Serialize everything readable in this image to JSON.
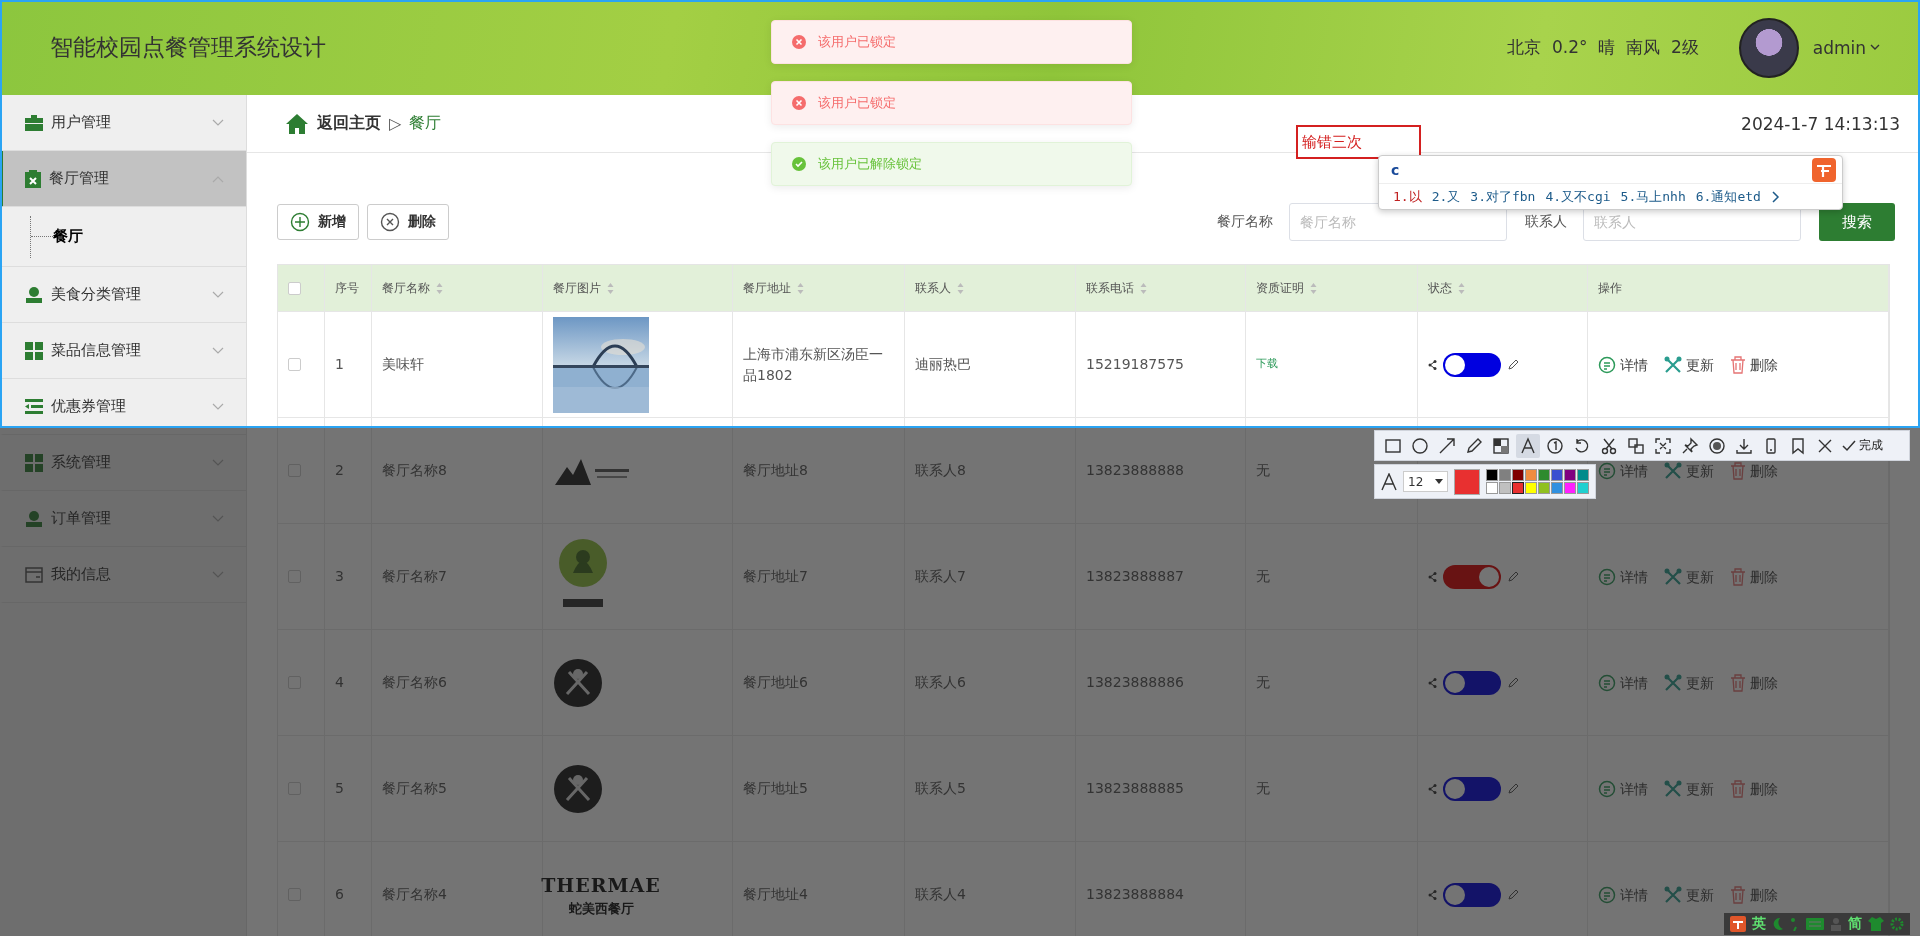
{
  "header": {
    "title": "智能校园点餐管理系统设计",
    "weather": "北京  0.2°  晴  南风  2级",
    "user": "admin"
  },
  "sidebar": {
    "items": [
      {
        "label": "用户管理",
        "expanded": false,
        "selected": false
      },
      {
        "label": "餐厅管理",
        "expanded": true,
        "selected": true,
        "children": [
          {
            "label": "餐厅",
            "selected": true
          }
        ]
      },
      {
        "label": "美食分类管理",
        "expanded": false,
        "selected": false
      },
      {
        "label": "菜品信息管理",
        "expanded": false,
        "selected": false
      },
      {
        "label": "优惠券管理",
        "expanded": false,
        "selected": false
      },
      {
        "label": "系统管理",
        "expanded": false,
        "selected": false
      },
      {
        "label": "订单管理",
        "expanded": false,
        "selected": false
      },
      {
        "label": "我的信息",
        "expanded": false,
        "selected": false
      }
    ]
  },
  "breadcrumb": {
    "home": "返回主页",
    "separator": "▷",
    "current": "餐厅",
    "datetime": "2024-1-7 14:13:13"
  },
  "actions": [
    {
      "label": "新增",
      "kind": "add"
    },
    {
      "label": "删除",
      "kind": "delete"
    }
  ],
  "search": {
    "fields": [
      {
        "label": "餐厅名称",
        "placeholder": "餐厅名称"
      },
      {
        "label": "联系人",
        "placeholder": "联系人"
      }
    ],
    "button": "搜索"
  },
  "table": {
    "select_all": {
      "checked": false
    },
    "columns": [
      {
        "label": "序号",
        "sortable": false
      },
      {
        "label": "餐厅名称",
        "sortable": true
      },
      {
        "label": "餐厅图片",
        "sortable": true
      },
      {
        "label": "餐厅地址",
        "sortable": true
      },
      {
        "label": "联系人",
        "sortable": true
      },
      {
        "label": "联系电话",
        "sortable": true
      },
      {
        "label": "资质证明",
        "sortable": true
      },
      {
        "label": "状态",
        "sortable": true
      },
      {
        "label": "操作",
        "sortable": false
      }
    ],
    "rows": [
      {
        "checked": false,
        "no": "1",
        "name": "美味轩",
        "address": "上海市浦东新区汤臣一品1802",
        "contact": "迪丽热巴",
        "phone": "15219187575",
        "certificate": {
          "text": "下载",
          "kind": "link"
        },
        "status": {
          "on": false
        },
        "operations": [
          "详情",
          "更新",
          "删除"
        ]
      },
      {
        "checked": false,
        "no": "2",
        "name": "餐厅名称8",
        "image": {
          "kind": "mountain"
        },
        "address": "餐厅地址8",
        "contact": "联系人8",
        "phone": "13823888888",
        "certificate": {
          "text": "无",
          "kind": "text"
        },
        "operations": [
          "详情",
          "更新",
          "删除"
        ]
      },
      {
        "checked": false,
        "no": "3",
        "name": "餐厅名称7",
        "image": {
          "kind": "badge"
        },
        "address": "餐厅地址7",
        "contact": "联系人7",
        "phone": "13823888887",
        "certificate": {
          "text": "无",
          "kind": "text"
        },
        "status": {
          "on": true
        },
        "operations": [
          "详情",
          "更新",
          "删除"
        ]
      },
      {
        "checked": false,
        "no": "4",
        "name": "餐厅名称6",
        "image": {
          "kind": "cutlery"
        },
        "address": "餐厅地址6",
        "contact": "联系人6",
        "phone": "13823888886",
        "certificate": {
          "text": "无",
          "kind": "text"
        },
        "status": {
          "on": false
        },
        "operations": [
          "详情",
          "更新",
          "删除"
        ]
      },
      {
        "checked": false,
        "no": "5",
        "name": "餐厅名称5",
        "image": {
          "kind": "cutlery"
        },
        "address": "餐厅地址5",
        "contact": "联系人5",
        "phone": "13823888885",
        "certificate": {
          "text": "无",
          "kind": "text"
        },
        "status": {
          "on": false
        },
        "operations": [
          "详情",
          "更新",
          "删除"
        ]
      },
      {
        "checked": false,
        "no": "6",
        "name": "餐厅名称4",
        "image": {
          "kind": "wordmark",
          "lines": [
            "THERMAE",
            "蛇美西餐厅"
          ]
        },
        "address": "餐厅地址4",
        "contact": "联系人4",
        "phone": "13823888884",
        "status": {
          "on": false
        },
        "operations": [
          "详情",
          "更新",
          "删除"
        ]
      }
    ]
  },
  "toasts": [
    {
      "text": "该用户已锁定",
      "kind": "error"
    },
    {
      "text": "该用户已锁定",
      "kind": "error"
    },
    {
      "text": "该用户已解除锁定",
      "kind": "success"
    }
  ],
  "annotation": {
    "text": "输错三次"
  },
  "ime": {
    "input": "c",
    "candidates": [
      "1.以",
      "2.又",
      "3.对了fbn",
      "4.又不cgi",
      "5.马上nhh",
      "6.通知etd"
    ]
  },
  "capture_toolbar": {
    "tools": [
      {
        "selected": false
      },
      {
        "selected": false
      },
      {
        "selected": false
      },
      {
        "selected": false
      },
      {
        "selected": false
      },
      {
        "selected": true
      },
      {
        "selected": false
      },
      {
        "selected": false
      },
      {
        "selected": false
      },
      {
        "selected": false
      },
      {
        "selected": false
      },
      {
        "selected": false
      },
      {
        "selected": false
      },
      {
        "selected": false
      },
      {
        "selected": false
      },
      {
        "selected": false
      },
      {
        "selected": false
      }
    ],
    "done": "完成",
    "font_size": "12",
    "palette": [
      {
        "color": "#000000",
        "selected": false
      },
      {
        "color": "#808080",
        "selected": false
      },
      {
        "color": "#800000",
        "selected": false
      },
      {
        "color": "#f08c40",
        "selected": false
      },
      {
        "color": "#2e8b2e",
        "selected": false
      },
      {
        "color": "#3a50d0",
        "selected": false
      },
      {
        "color": "#800080",
        "selected": false
      },
      {
        "color": "#008b8b",
        "selected": false
      },
      {
        "color": "#ffffff",
        "selected": false
      },
      {
        "color": "#c0c0c0",
        "selected": false
      },
      {
        "color": "#e83030",
        "selected": true
      },
      {
        "color": "#ffff00",
        "selected": false
      },
      {
        "color": "#90c020",
        "selected": false
      },
      {
        "color": "#3090e0",
        "selected": false
      },
      {
        "color": "#ff20ff",
        "selected": false
      },
      {
        "color": "#20d0d0",
        "selected": false
      }
    ]
  },
  "tray": {
    "items": [
      {
        "kind": "logo"
      },
      {
        "kind": "text",
        "text": "英"
      },
      {
        "kind": "moon"
      },
      {
        "kind": "punct"
      },
      {
        "kind": "keyboard"
      },
      {
        "kind": "person"
      },
      {
        "kind": "text",
        "text": "简"
      },
      {
        "kind": "shirt"
      },
      {
        "kind": "gear"
      }
    ]
  }
}
